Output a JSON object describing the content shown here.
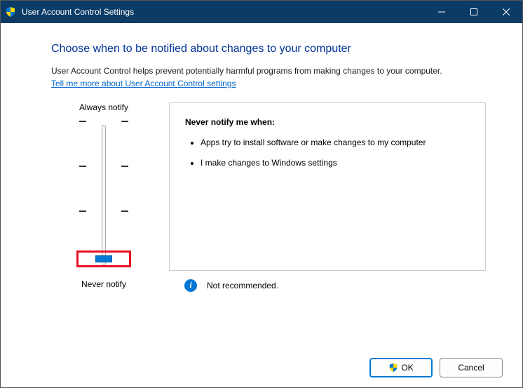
{
  "titlebar": {
    "title": "User Account Control Settings"
  },
  "heading": "Choose when to be notified about changes to your computer",
  "description": "User Account Control helps prevent potentially harmful programs from making changes to your computer.",
  "link": "Tell me more about User Account Control settings",
  "slider": {
    "top_label": "Always notify",
    "bottom_label": "Never notify"
  },
  "panel": {
    "title": "Never notify me when:",
    "bullets": [
      "Apps try to install software or make changes to my computer",
      "I make changes to Windows settings"
    ]
  },
  "note": "Not recommended.",
  "buttons": {
    "ok": "OK",
    "cancel": "Cancel"
  }
}
